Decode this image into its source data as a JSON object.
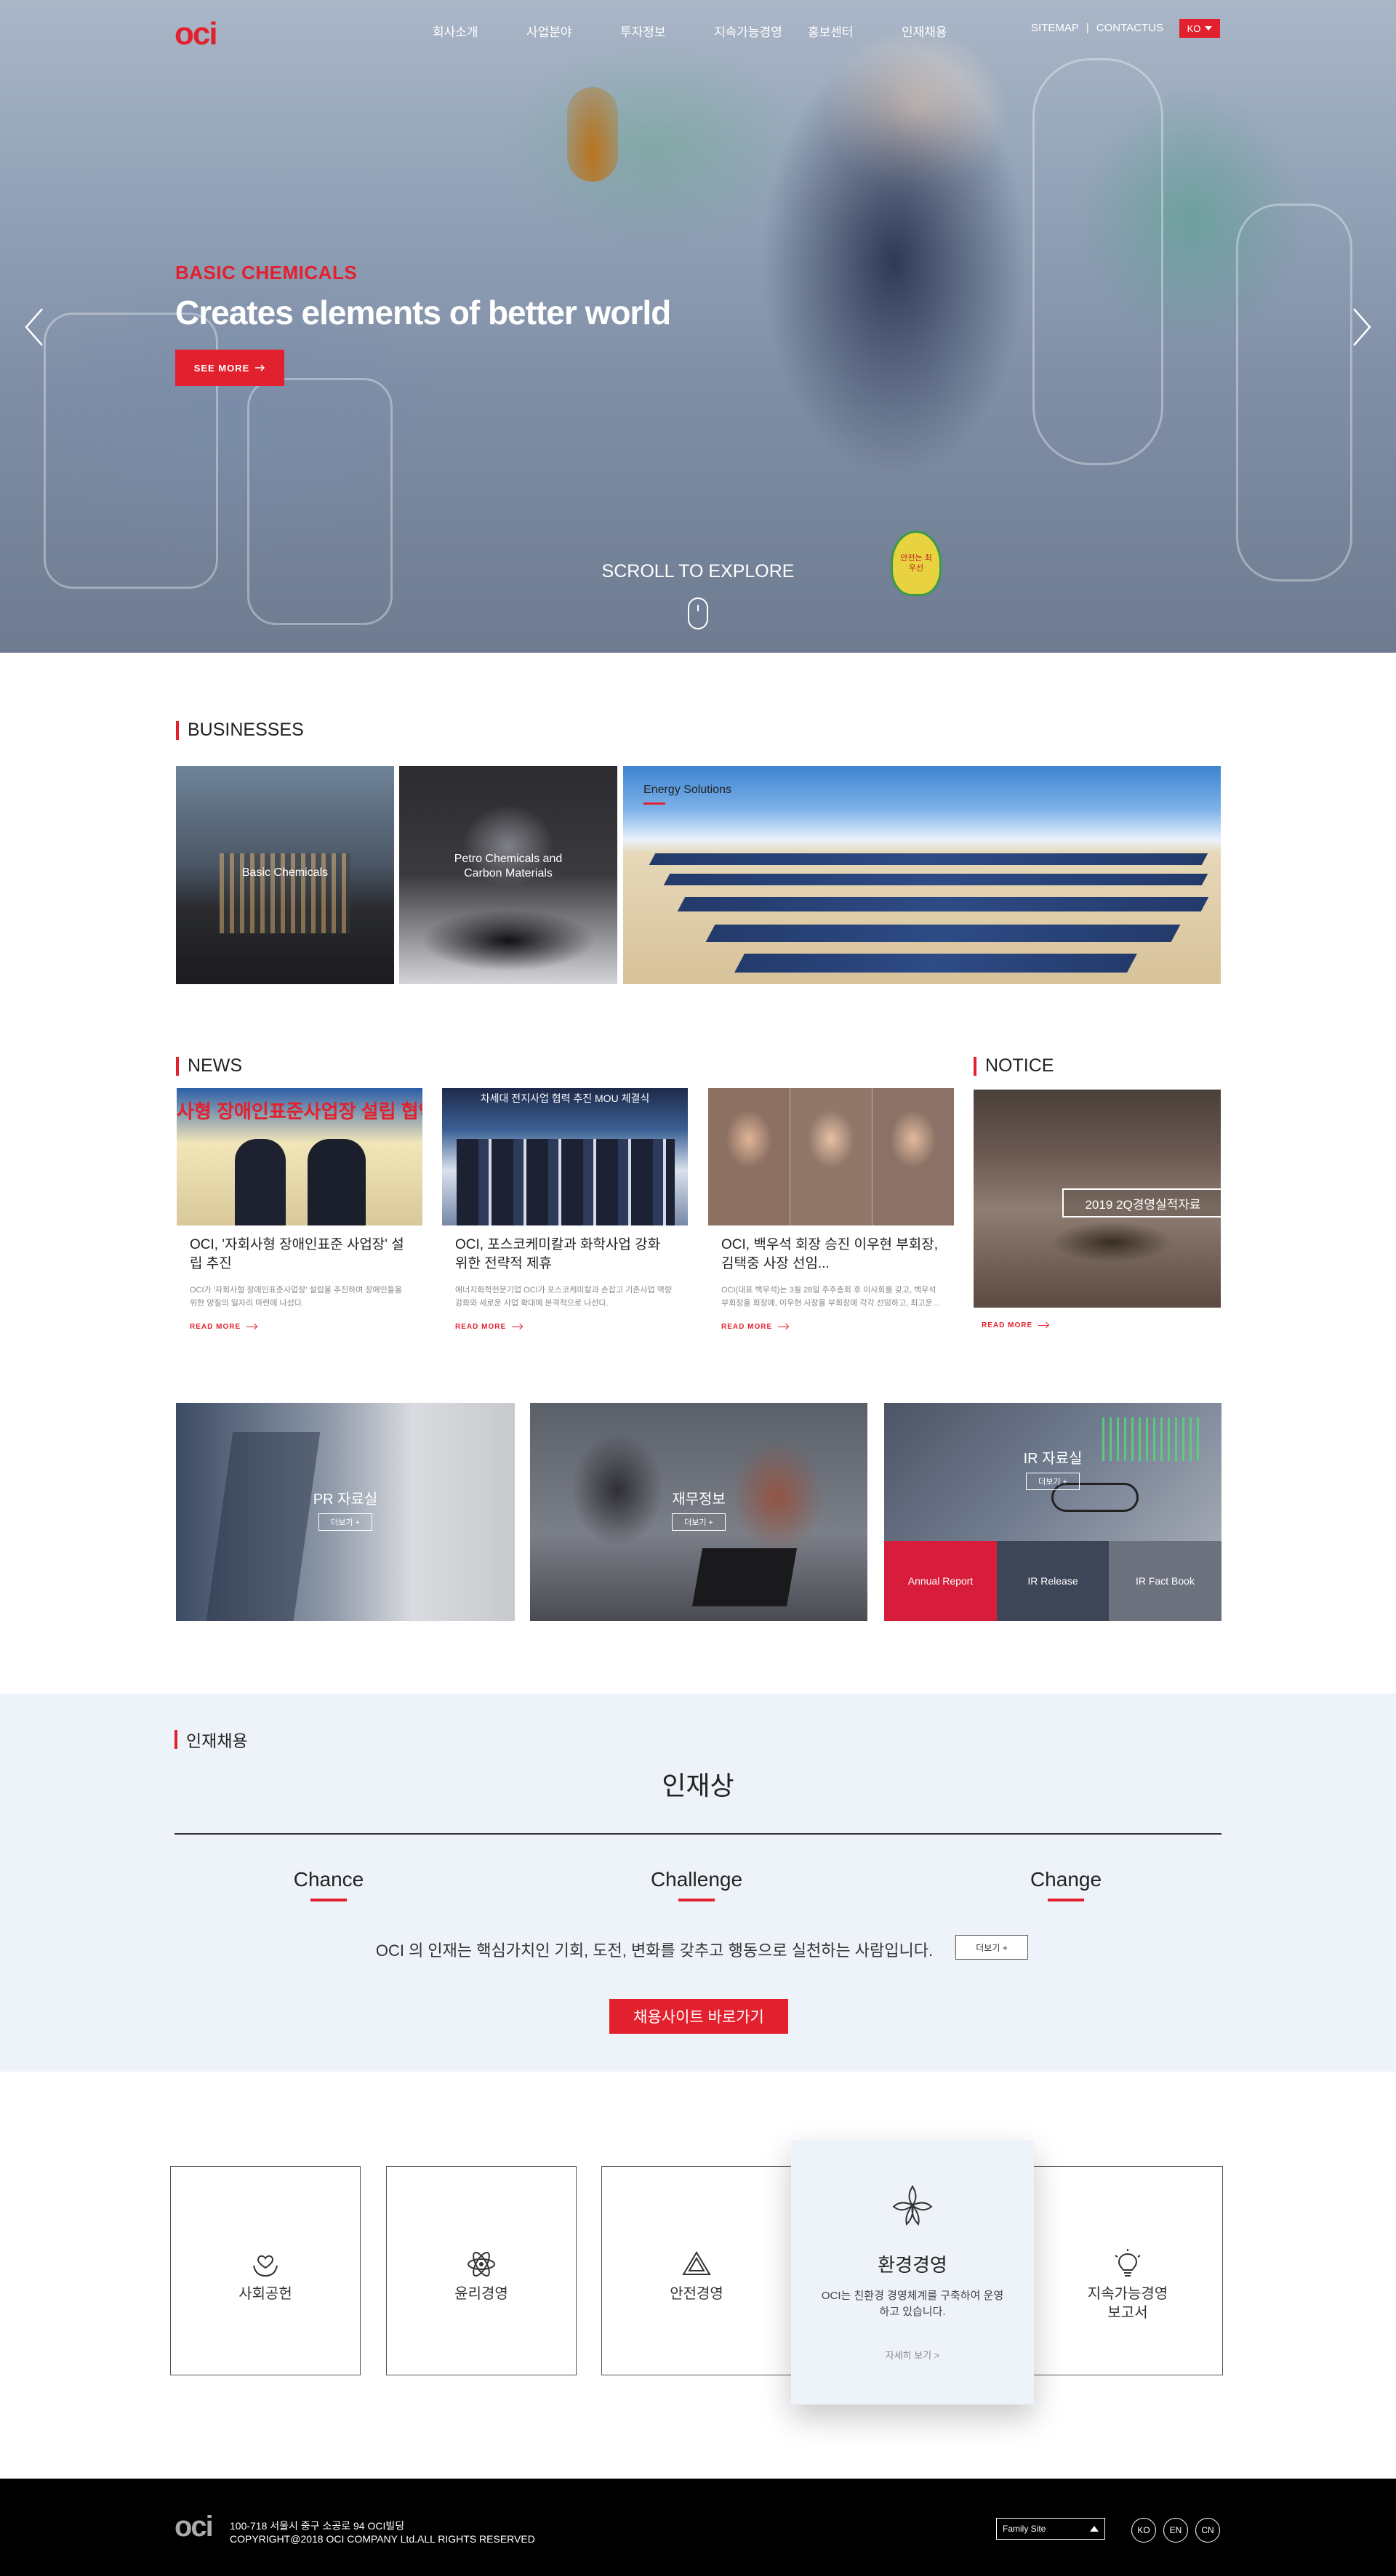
{
  "header": {
    "logo": "oci",
    "nav": [
      "회사소개",
      "사업분야",
      "투자정보",
      "지속가능경영",
      "홍보센터",
      "인재채용"
    ],
    "util": {
      "sitemap": "SITEMAP",
      "divider": "|",
      "contact": "CONTACTUS"
    },
    "lang": "KO"
  },
  "hero": {
    "subtitle": "BASIC CHEMICALS",
    "title": "Creates elements of better world",
    "button": "SEE MORE",
    "scroll": "SCROLL TO EXPLORE",
    "badge_text": "안전는 최우선"
  },
  "businesses": {
    "title": "BUSINESSES",
    "items": [
      "Basic Chemicals",
      "Petro Chemicals and Carbon Materials",
      "Energy Solutions"
    ]
  },
  "news": {
    "title": "NEWS",
    "items": [
      {
        "img_text": "사형 장애인표준사업장 설립 협약",
        "title": "OCI, '자회사형 장애인표준 사업장' 설립 추진",
        "desc": "OCI가 '자회사형 장애인표준사업장' 설립을 추진하며 장애인들을 위한 양질의 일자리 마련에 나섰다.",
        "more": "READ MORE"
      },
      {
        "img_text": "차세대 전지사업 협력 추진 MOU 체결식",
        "title": "OCI, 포스코케미칼과 화학사업 강화 위한 전략적 제휴",
        "desc": "에너지화학전문기업 OCI가 포스코케미칼과 손잡고 기존사업 역량 강화와 새로운 사업 확대에 본격적으로 나선다.",
        "more": "READ MORE"
      },
      {
        "img_text": "",
        "title": "OCI, 백우석 회장 승진 이우현 부회장, 김택중 사장 선임...",
        "desc": "OCI(대표 백우석)는 3월 28일 주주총회 후 이사회를 갖고, 백우석 부회장을 회장에, 이우현 사장을 부회장에 각각 선임하고, 최고운...",
        "more": "READ MORE"
      }
    ]
  },
  "notice": {
    "title": "NOTICE",
    "box": "2019 2Q경영실적자료",
    "more": "READ MORE"
  },
  "tiles": {
    "pr": {
      "label": "PR 자료실",
      "more": "더보기 +"
    },
    "finance": {
      "label": "재무정보",
      "more": "더보기 +"
    },
    "ir": {
      "label": "IR 자료실",
      "more": "더보기 +",
      "buttons": [
        "Annual Report",
        "IR Release",
        "IR Fact Book"
      ]
    }
  },
  "recruit": {
    "section_title": "인재채용",
    "heading": "인재상",
    "values": [
      "Chance",
      "Challenge",
      "Change"
    ],
    "desc": "OCI 의 인재는 핵심가치인 기회, 도전, 변화를 갖추고 행동으로 실천하는 사람입니다.",
    "more": "더보기 +",
    "cta": "채용사이트 바로가기"
  },
  "esg": {
    "cards": [
      {
        "label": "사회공헌",
        "icon": "hands-heart-icon"
      },
      {
        "label": "윤리경영",
        "icon": "atom-icon"
      },
      {
        "label": "안전경영",
        "icon": "recycle-triangle-icon"
      },
      {
        "label": "지속가능경영\n보고서",
        "icon": "lightbulb-icon"
      }
    ],
    "active": {
      "title": "환경경영",
      "desc": "OCI는 친환경 경영체계를 구축하여 운영하고 있습니다.",
      "link": "자세히 보기 >",
      "icon": "leaf-star-icon"
    }
  },
  "footer": {
    "logo": "oci",
    "address": "100-718 서울시 중구 소공로 94 OCI빌딩",
    "copyright": "COPYRIGHT@2018 OCI COMPANY Ltd.ALL RIGHTS RESERVED",
    "family_site": "Family Site",
    "langs": [
      "KO",
      "EN",
      "CN"
    ]
  },
  "colors": {
    "brand_red": "#e3202e",
    "recruit_bg": "#eef2f9",
    "footer_bg": "#000000"
  }
}
